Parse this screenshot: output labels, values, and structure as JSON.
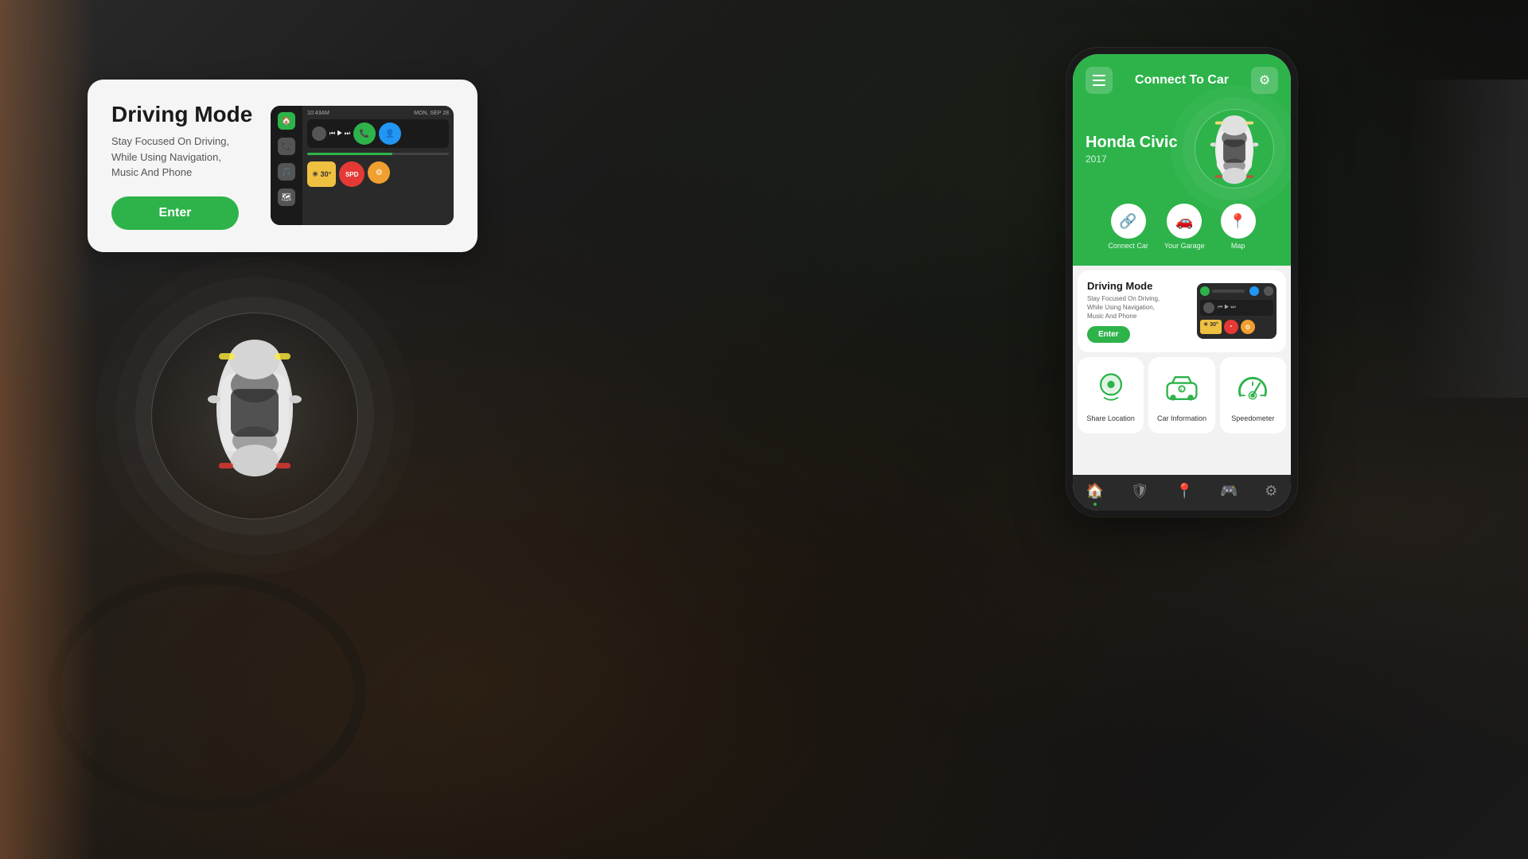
{
  "app": {
    "title": "Connect To Car",
    "background_desc": "Car interior dashboard background"
  },
  "driving_mode_card": {
    "title": "Driving Mode",
    "description": "Stay Focused On Driving,\nWhile Using Navigation,\nMusic And Phone",
    "enter_button": "Enter"
  },
  "phone": {
    "header": {
      "title": "Connect To Car",
      "hamburger_label": "Menu",
      "settings_label": "Settings"
    },
    "car": {
      "name": "Honda Civic",
      "year": "2017"
    },
    "quick_actions": [
      {
        "icon": "🔗",
        "label": "Connect Car"
      },
      {
        "icon": "🚗",
        "label": "Your Garage"
      },
      {
        "icon": "📍",
        "label": "Map"
      }
    ],
    "driving_mode": {
      "title": "Driving Mode",
      "description": "Stay Focused On Driving,\nWhile Using Navigation,\nMusic And Phone",
      "enter_button": "Enter"
    },
    "features": [
      {
        "icon": "📍",
        "label": "Share Location"
      },
      {
        "icon": "🚗",
        "label": "Car Information"
      },
      {
        "icon": "⚡",
        "label": "Speedometer"
      }
    ],
    "nav": [
      {
        "icon": "🏠",
        "label": "Home",
        "active": true
      },
      {
        "icon": "🛡",
        "label": "Security",
        "active": false
      },
      {
        "icon": "📍",
        "label": "Location",
        "active": false
      },
      {
        "icon": "🎮",
        "label": "Control",
        "active": false
      },
      {
        "icon": "⚙",
        "label": "Settings",
        "active": false
      }
    ]
  },
  "colors": {
    "primary_green": "#2db34a",
    "dark_bg": "#1a1a1a",
    "card_bg": "#ffffff",
    "text_dark": "#1a1a1a",
    "text_muted": "#666666"
  }
}
